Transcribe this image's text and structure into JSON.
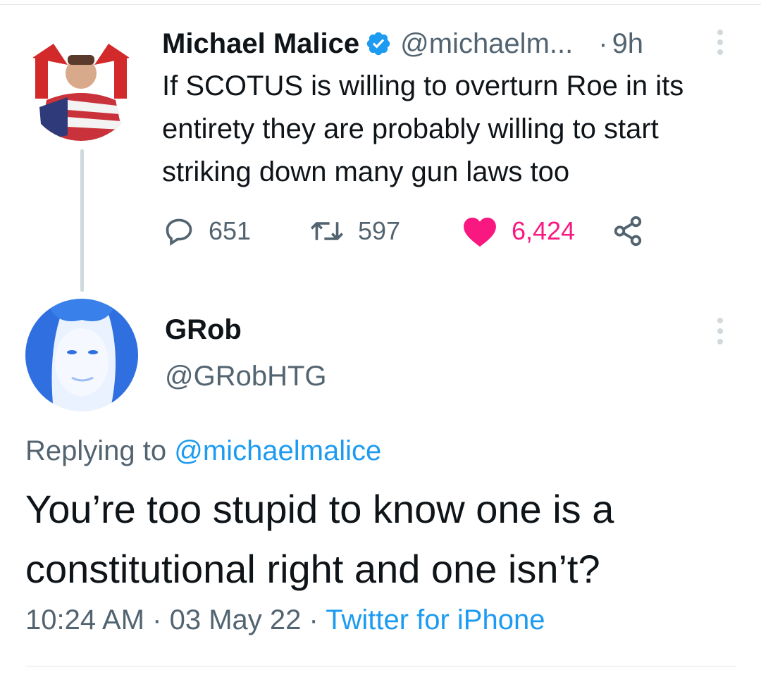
{
  "parent_tweet": {
    "author_name": "Michael Malice",
    "handle": "@michaelm...",
    "separator": "·",
    "time": "9h",
    "text": "If SCOTUS is willing to overturn Roe in its entirety they are probably willing to start striking down many gun laws too",
    "replies": "651",
    "retweets": "597",
    "likes": "6,424",
    "liked": true
  },
  "reply_tweet": {
    "author_name": "GRob",
    "handle": "@GRobHTG",
    "replying_prefix": "Replying to",
    "replying_to": "@michaelmalice",
    "text": "You’re too stupid to know one is a constitutional right and one isn’t?",
    "time": "10:24 AM",
    "sep1": "·",
    "date": "03 May 22",
    "sep2": "·",
    "source": "Twitter for iPhone"
  },
  "colors": {
    "accent": "#1d9bf0",
    "like": "#f91880",
    "secondary_text": "#536471",
    "primary_text": "#0f1419"
  },
  "icons": [
    "verified-badge-icon",
    "more-options-icon",
    "reply-icon",
    "retweet-icon",
    "heart-icon",
    "share-icon"
  ]
}
